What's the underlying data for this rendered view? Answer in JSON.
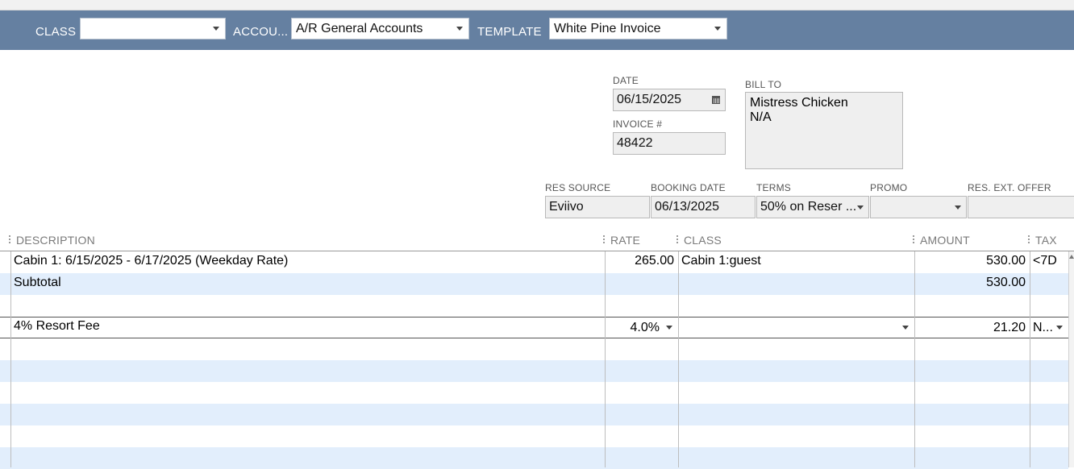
{
  "header": {
    "class_label": "CLASS",
    "class_value": "",
    "account_label": "ACCOU...",
    "account_value": "A/R General Accounts",
    "template_label": "TEMPLATE",
    "template_value": "White Pine Invoice"
  },
  "form": {
    "date_label": "DATE",
    "date_value": "06/15/2025",
    "invoice_label": "INVOICE #",
    "invoice_value": "48422",
    "billto_label": "BILL TO",
    "billto_line1": "Mistress Chicken",
    "billto_line2": "N/A",
    "res_source_label": "RES SOURCE",
    "res_source_value": "Eviivo",
    "booking_date_label": "BOOKING DATE",
    "booking_date_value": "06/13/2025",
    "terms_label": "TERMS",
    "terms_value": "50% on Reser ...",
    "promo_label": "PROMO",
    "promo_value": "",
    "res_ext_offer_label": "RES. EXT. OFFER",
    "res_ext_offer_value": ""
  },
  "table": {
    "columns": {
      "description": "DESCRIPTION",
      "rate": "RATE",
      "class": "CLASS",
      "amount": "AMOUNT",
      "tax": "TAX"
    },
    "rows": [
      {
        "description": "Cabin 1: 6/15/2025 - 6/17/2025 (Weekday Rate)",
        "rate": "265.00",
        "class": "Cabin 1:guest",
        "amount": "530.00",
        "tax": "<7D"
      },
      {
        "description": "Subtotal",
        "rate": "",
        "class": "",
        "amount": "530.00",
        "tax": ""
      },
      {
        "description": "",
        "rate": "",
        "class": "",
        "amount": "",
        "tax": ""
      },
      {
        "description": "4% Resort Fee",
        "rate": "4.0%",
        "class": "",
        "amount": "21.20",
        "tax": "N..."
      }
    ]
  },
  "icons": {
    "calendar": "calendar-icon",
    "dropdown": "chevron-down-icon"
  }
}
